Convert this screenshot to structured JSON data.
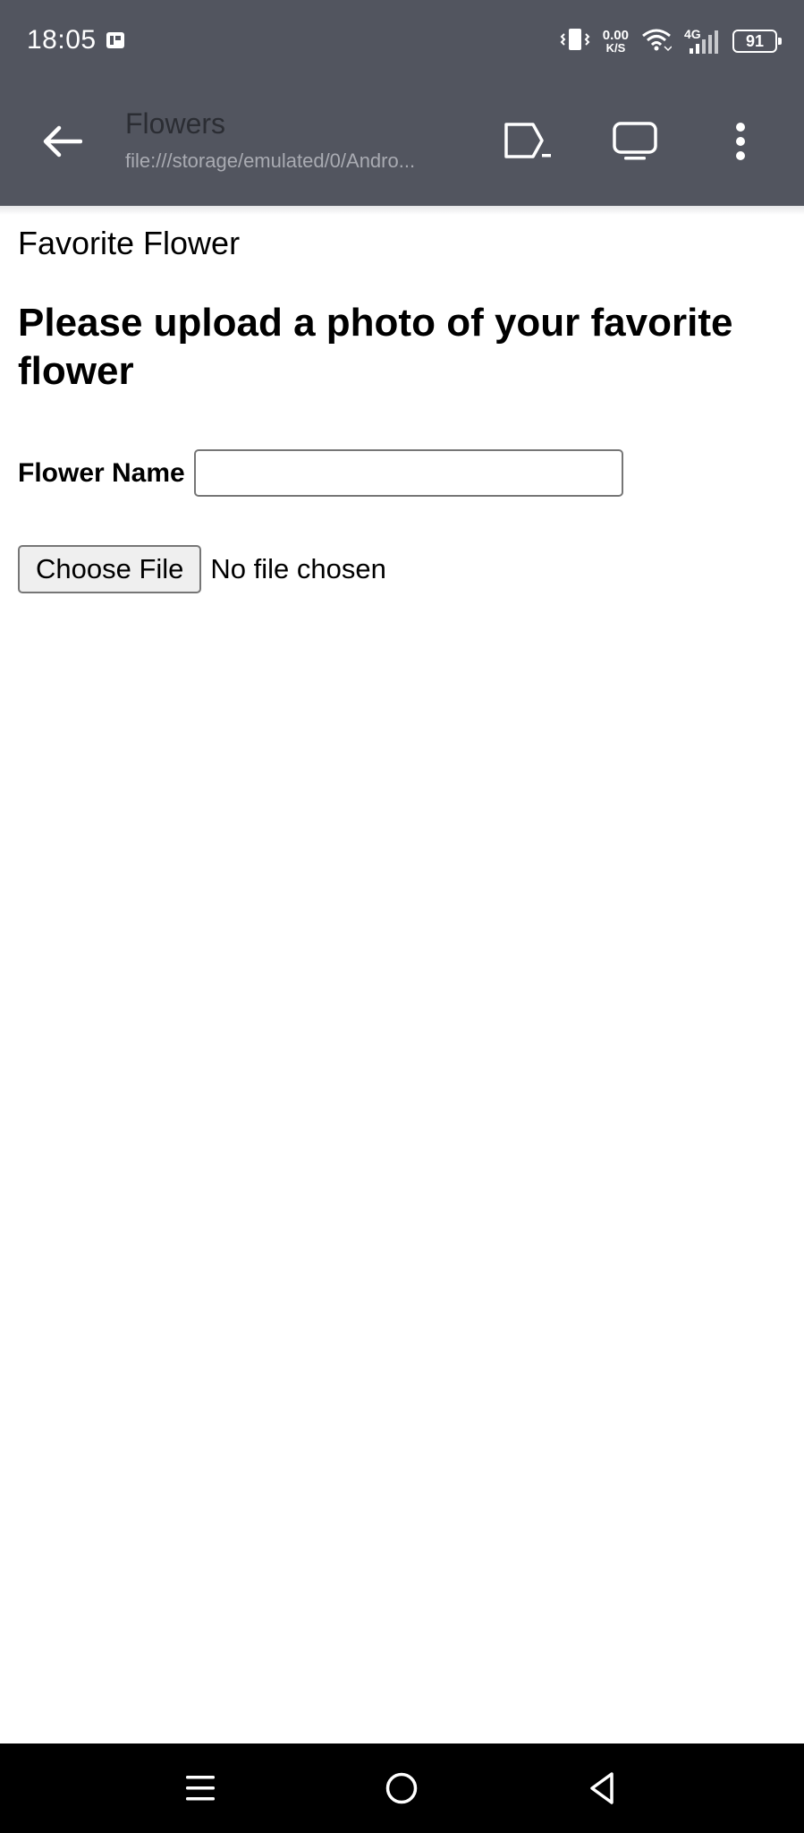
{
  "status_bar": {
    "time": "18:05",
    "net_speed_value": "0.00",
    "net_speed_unit": "K/S",
    "network_type": "4G",
    "battery_level": "91",
    "icons": [
      "app-notification-icon",
      "vibrate-icon",
      "wifi-icon",
      "signal-icon",
      "battery-icon"
    ]
  },
  "app_bar": {
    "title": "Flowers",
    "url": "file:///storage/emulated/0/Andro...",
    "icons": [
      "back-arrow-icon",
      "tab-switch-icon",
      "desktop-icon",
      "more-vert-icon"
    ]
  },
  "page": {
    "title": "Favorite Flower",
    "heading": "Please upload a photo of your favorite flower",
    "form": {
      "flower_name_label": "Flower Name",
      "flower_name_value": "",
      "choose_file_label": "Choose File",
      "file_status": "No file chosen"
    }
  },
  "nav_bar": {
    "icons": [
      "menu-icon",
      "home-icon",
      "back-icon"
    ]
  },
  "colors": {
    "top_bar": "#52555f",
    "title_text": "#2b2d33",
    "url_text": "#a9abb2",
    "nav_bar": "#000000"
  }
}
